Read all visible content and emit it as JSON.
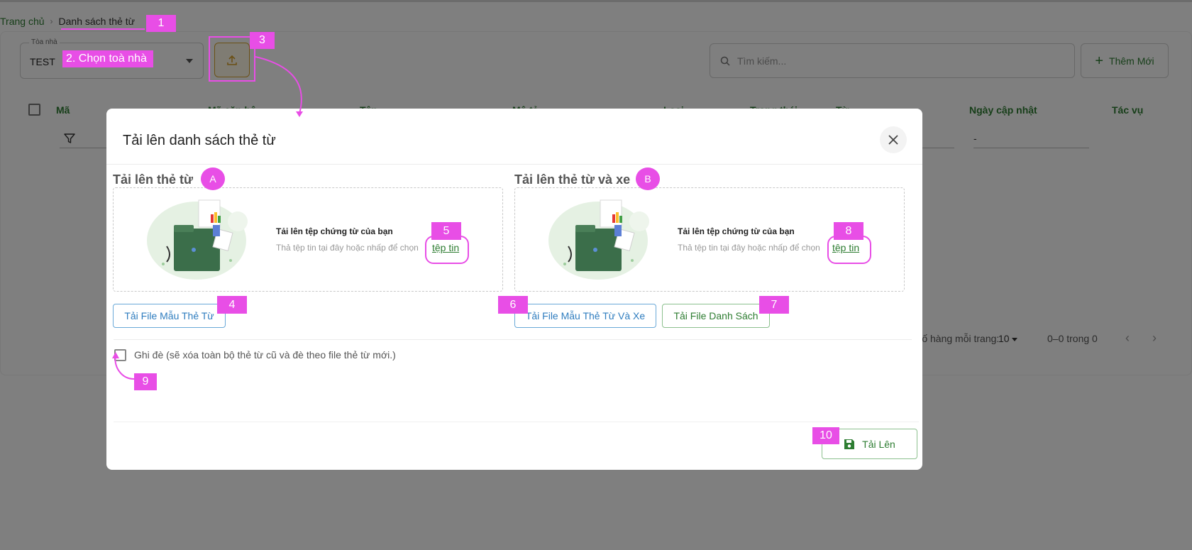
{
  "breadcrumb": {
    "home": "Trang chủ",
    "separator": "›",
    "current": "Danh sách thẻ từ"
  },
  "building_select": {
    "label": "Tòa nhà",
    "value": "TEST"
  },
  "search": {
    "placeholder": "Tìm kiếm..."
  },
  "add_new": {
    "label": "Thêm Mới",
    "icon": "plus-icon"
  },
  "table": {
    "columns": [
      "Mã",
      "Mã căn hộ",
      "Tên",
      "Mô tả",
      "Loại",
      "Trạng thái",
      "Từ",
      "Ngày cập nhật",
      "Tác vụ"
    ],
    "date_filter_value": "-"
  },
  "pagination": {
    "rows_per_page_label": "Số hàng mỗi trang:",
    "rows_per_page": "10",
    "range": "0–0 trong 0"
  },
  "modal": {
    "title": "Tải lên danh sách thẻ từ",
    "section_a": {
      "title": "Tải lên thẻ từ",
      "dropzone_title": "Tải lên tệp chứng từ của bạn",
      "dropzone_hint": "Thả tệp tin tại đây hoặc nhấp để chọn",
      "dropzone_link": "tệp tin"
    },
    "section_b": {
      "title": "Tải lên thẻ từ và xe",
      "dropzone_title": "Tải lên tệp chứng từ của bạn",
      "dropzone_hint": "Thả tệp tin tại đây hoặc nhấp để chọn",
      "dropzone_link": "tệp tin"
    },
    "buttons": {
      "template_card": "Tải File Mẫu Thẻ Từ",
      "template_card_vehicle": "Tải File Mẫu Thẻ Từ Và Xe",
      "download_list": "Tải File Danh Sách",
      "submit": "Tải Lên"
    },
    "overwrite_label": "Ghi đè (sẽ xóa toàn bộ thẻ từ cũ và đè theo file thẻ từ mới.)"
  },
  "annotations": {
    "a1": "1",
    "a2": "2. Chọn toà nhà",
    "a3": "3",
    "a4": "4",
    "a5": "5",
    "a6": "6",
    "a7": "7",
    "a8": "8",
    "a9": "9",
    "a10": "10",
    "aA": "A",
    "aB": "B"
  },
  "colors": {
    "accent_green": "#2e7d32",
    "accent_blue": "#2f7dbf",
    "annotation": "#e84ee6",
    "upload_orange": "#d6a02a"
  }
}
